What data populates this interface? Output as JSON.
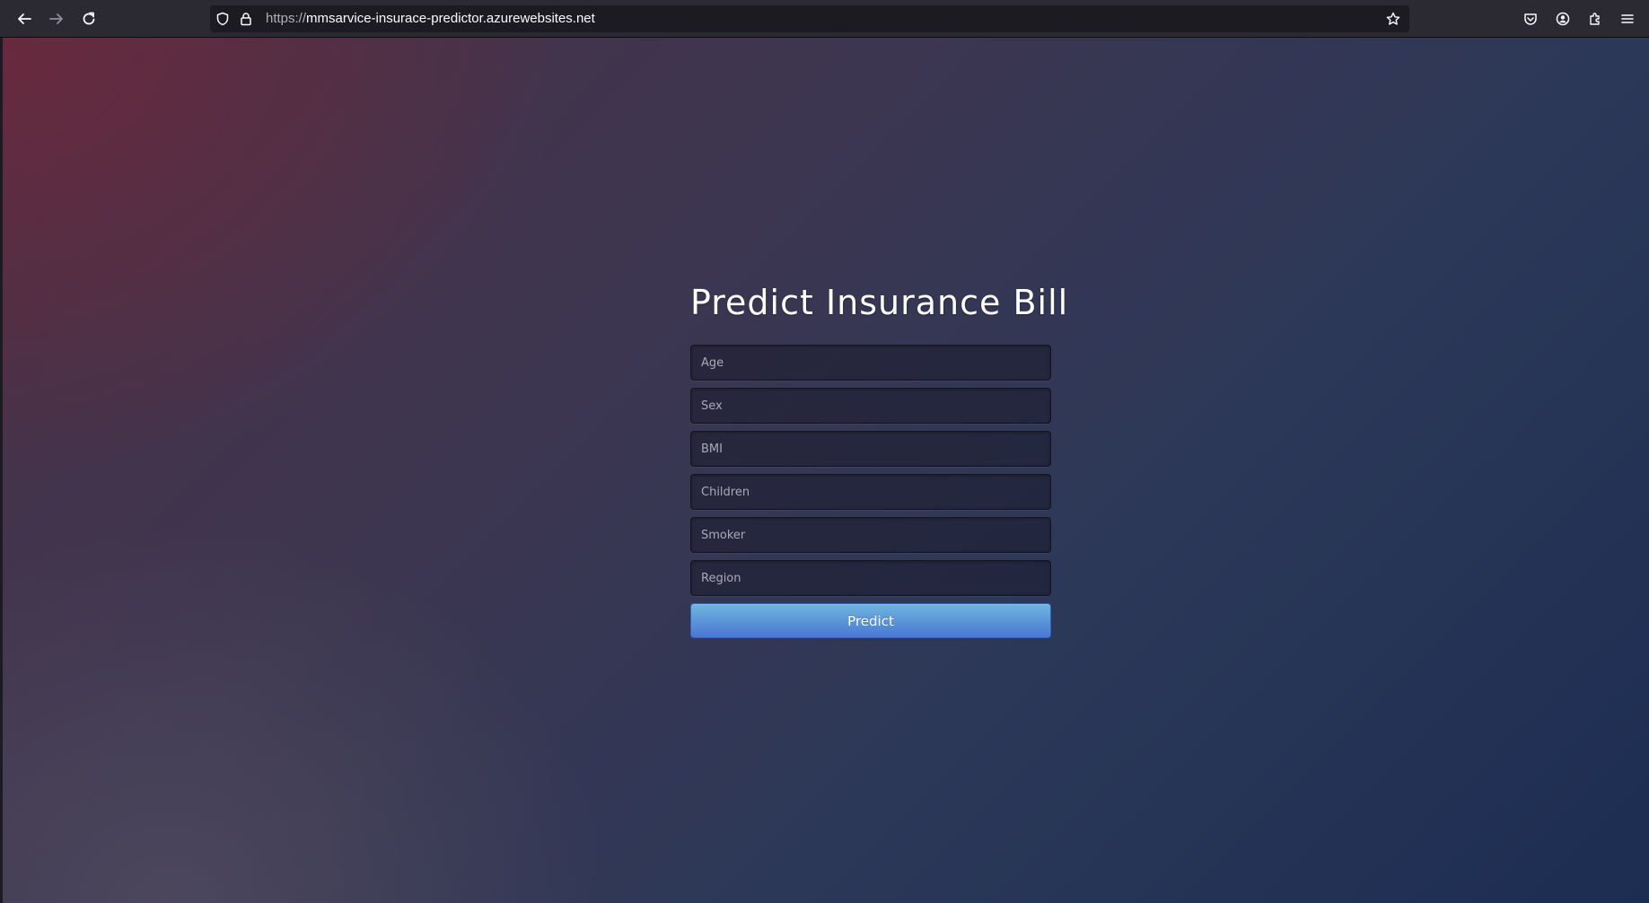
{
  "browser": {
    "url_scheme": "https://",
    "url_host": "mmsarvice-insurace-predictor.azurewebsites.net",
    "icons": {
      "back": "back-arrow-icon",
      "forward": "forward-arrow-icon",
      "reload": "reload-icon",
      "tracking_protection": "shield-icon",
      "lock": "lock-icon",
      "bookmark": "star-icon",
      "pocket": "pocket-icon",
      "account": "account-icon",
      "extensions": "puzzle-icon",
      "menu": "hamburger-menu-icon"
    }
  },
  "page": {
    "title": "Predict Insurance Bill",
    "fields": [
      {
        "placeholder": "Age",
        "value": ""
      },
      {
        "placeholder": "Sex",
        "value": ""
      },
      {
        "placeholder": "BMI",
        "value": ""
      },
      {
        "placeholder": "Children",
        "value": ""
      },
      {
        "placeholder": "Smoker",
        "value": ""
      },
      {
        "placeholder": "Region",
        "value": ""
      }
    ],
    "submit_label": "Predict"
  },
  "colors": {
    "button_top": "#6eb6de",
    "button_bottom": "#4a77d4",
    "background_top_left": "#6e283c",
    "background_bottom_right": "#1c2d52"
  }
}
